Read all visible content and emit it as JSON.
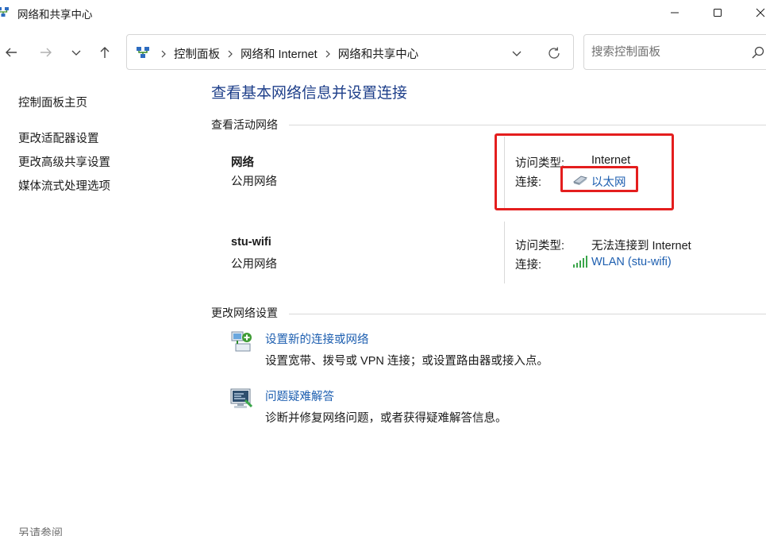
{
  "window": {
    "title": "网络和共享中心"
  },
  "address": {
    "crumbs": [
      "控制面板",
      "网络和 Internet",
      "网络和共享中心"
    ]
  },
  "search": {
    "placeholder": "搜索控制面板"
  },
  "sidebar": {
    "items": [
      {
        "label": "控制面板主页"
      },
      {
        "label": "更改适配器设置"
      },
      {
        "label": "更改高级共享设置"
      },
      {
        "label": "媒体流式处理选项"
      }
    ],
    "see_also": "另请参阅"
  },
  "main": {
    "title": "查看基本网络信息并设置连接",
    "active_networks_heading": "查看活动网络",
    "networks": [
      {
        "name": "网络",
        "type": "公用网络",
        "access_label": "访问类型:",
        "access_value": "Internet",
        "connection_label": "连接:",
        "connection_value": "以太网",
        "connection_icon": "ethernet-icon"
      },
      {
        "name": "stu-wifi",
        "type": "公用网络",
        "access_label": "访问类型:",
        "access_value": "无法连接到 Internet",
        "connection_label": "连接:",
        "connection_value": "WLAN (stu-wifi)",
        "connection_icon": "wifi-signal-icon"
      }
    ],
    "change_settings_heading": "更改网络设置",
    "tasks": [
      {
        "title": "设置新的连接或网络",
        "description": "设置宽带、拨号或 VPN 连接；或设置路由器或接入点。",
        "icon": "new-connection-icon"
      },
      {
        "title": "问题疑难解答",
        "description": "诊断并修复网络问题，或者获得疑难解答信息。",
        "icon": "troubleshoot-icon"
      }
    ]
  },
  "colors": {
    "link": "#1e5fb0",
    "title": "#1e3f8a",
    "highlight": "#e41e1e"
  }
}
